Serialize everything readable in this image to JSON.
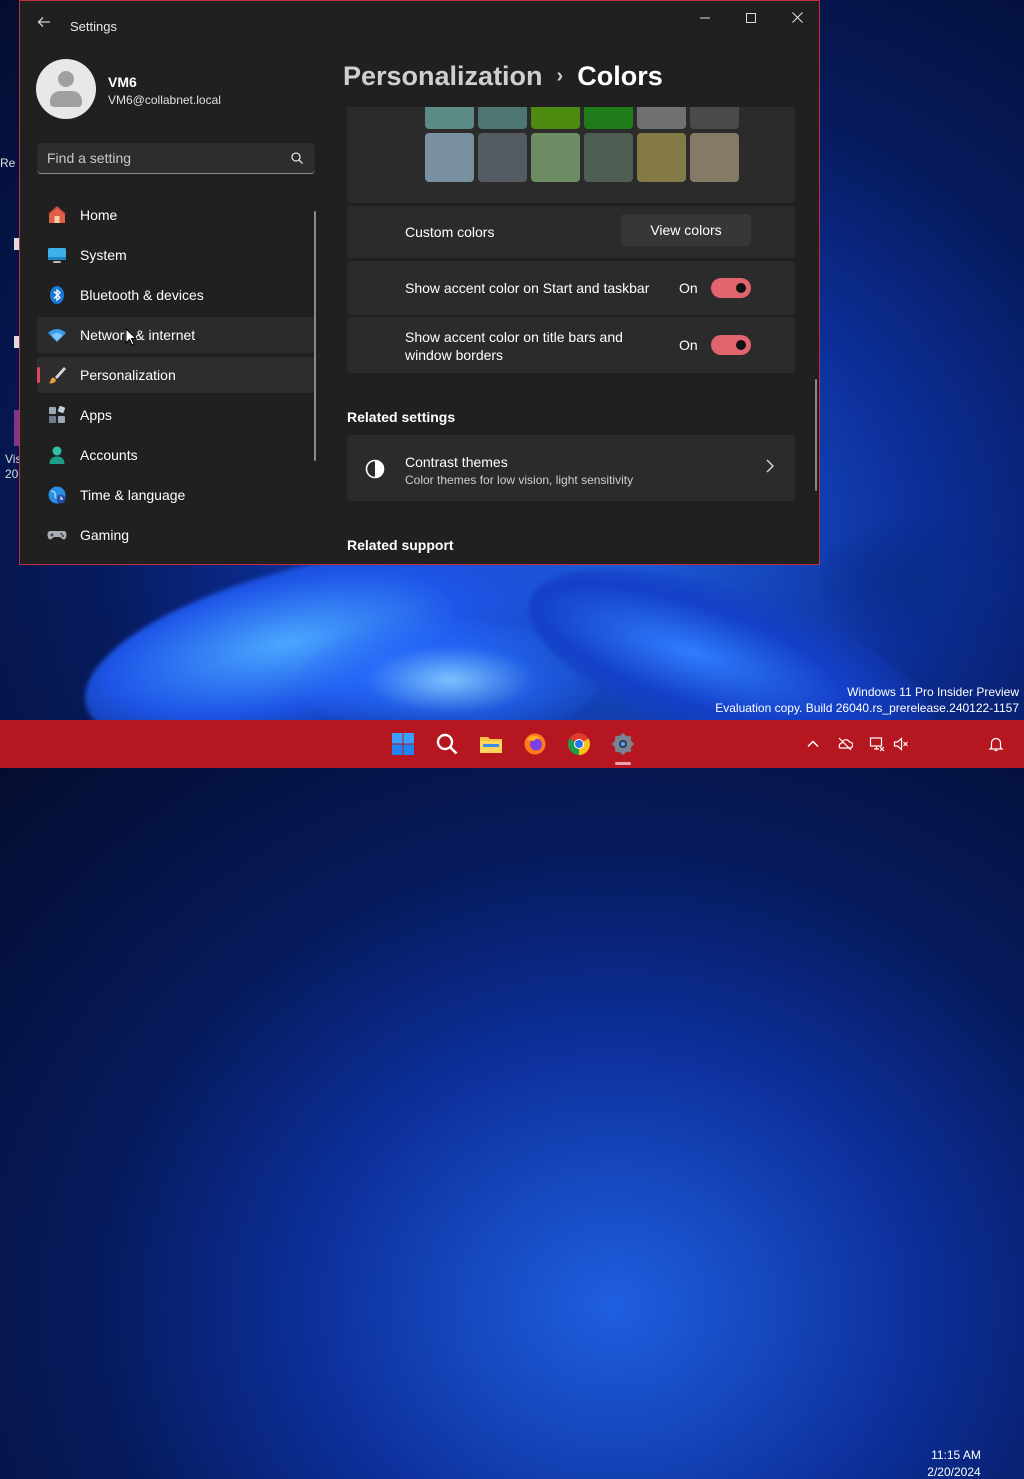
{
  "window": {
    "title": "Settings",
    "controls": {
      "minimize": "—",
      "maximize": "☐",
      "close": "✕"
    }
  },
  "user": {
    "name": "VM6",
    "email": "VM6@collabnet.local"
  },
  "search": {
    "placeholder": "Find a setting",
    "value": ""
  },
  "nav": {
    "items": [
      {
        "label": "Home",
        "icon": "home-icon"
      },
      {
        "label": "System",
        "icon": "system-icon"
      },
      {
        "label": "Bluetooth & devices",
        "icon": "bluetooth-icon"
      },
      {
        "label": "Network & internet",
        "icon": "wifi-icon",
        "state": "hover"
      },
      {
        "label": "Personalization",
        "icon": "brush-icon",
        "state": "selected"
      },
      {
        "label": "Apps",
        "icon": "apps-icon"
      },
      {
        "label": "Accounts",
        "icon": "person-icon"
      },
      {
        "label": "Time & language",
        "icon": "globe-icon"
      },
      {
        "label": "Gaming",
        "icon": "gamepad-icon"
      }
    ]
  },
  "breadcrumb": {
    "parent": "Personalization",
    "separator": "›",
    "current": "Colors"
  },
  "colors": {
    "swatch_row1": [
      "#5c8a84",
      "#4d7571",
      "#4c8a10",
      "#1e7d1a",
      "#6f7070",
      "#4a4a4a"
    ],
    "swatch_row2": [
      "#7890a0",
      "#545b63",
      "#6c8c63",
      "#4f5e52",
      "#847a45",
      "#857a66"
    ],
    "accent": "#e0656e",
    "taskbar": "#b5161f",
    "window_border": "#c03040"
  },
  "settings": {
    "custom_colors": {
      "label": "Custom colors",
      "button": "View colors"
    },
    "accent_start": {
      "label": "Show accent color on Start and taskbar",
      "state": "On",
      "on": true
    },
    "accent_title": {
      "label": "Show accent color on title bars and window borders",
      "state": "On",
      "on": true
    }
  },
  "related_settings": {
    "title": "Related settings",
    "contrast": {
      "title": "Contrast themes",
      "subtitle": "Color themes for low vision, light sensitivity",
      "icon": "contrast-icon"
    }
  },
  "related_support": {
    "title": "Related support"
  },
  "watermark": {
    "line1": "Windows 11 Pro Insider Preview",
    "line2": "Evaluation copy. Build 26040.rs_prerelease.240122-1157"
  },
  "taskbar": {
    "apps": [
      "start-icon",
      "search-icon",
      "file-explorer-icon",
      "firefox-icon",
      "chrome-icon",
      "settings-icon"
    ],
    "tray": [
      "chevron-up-icon",
      "onedrive-icon",
      "network-icon",
      "volume-muted-icon",
      "notification-icon"
    ],
    "time": "11:15 AM",
    "date": "2/20/2024"
  },
  "desktop": {
    "partial_labels": [
      "Re",
      "Vis",
      "20"
    ]
  }
}
